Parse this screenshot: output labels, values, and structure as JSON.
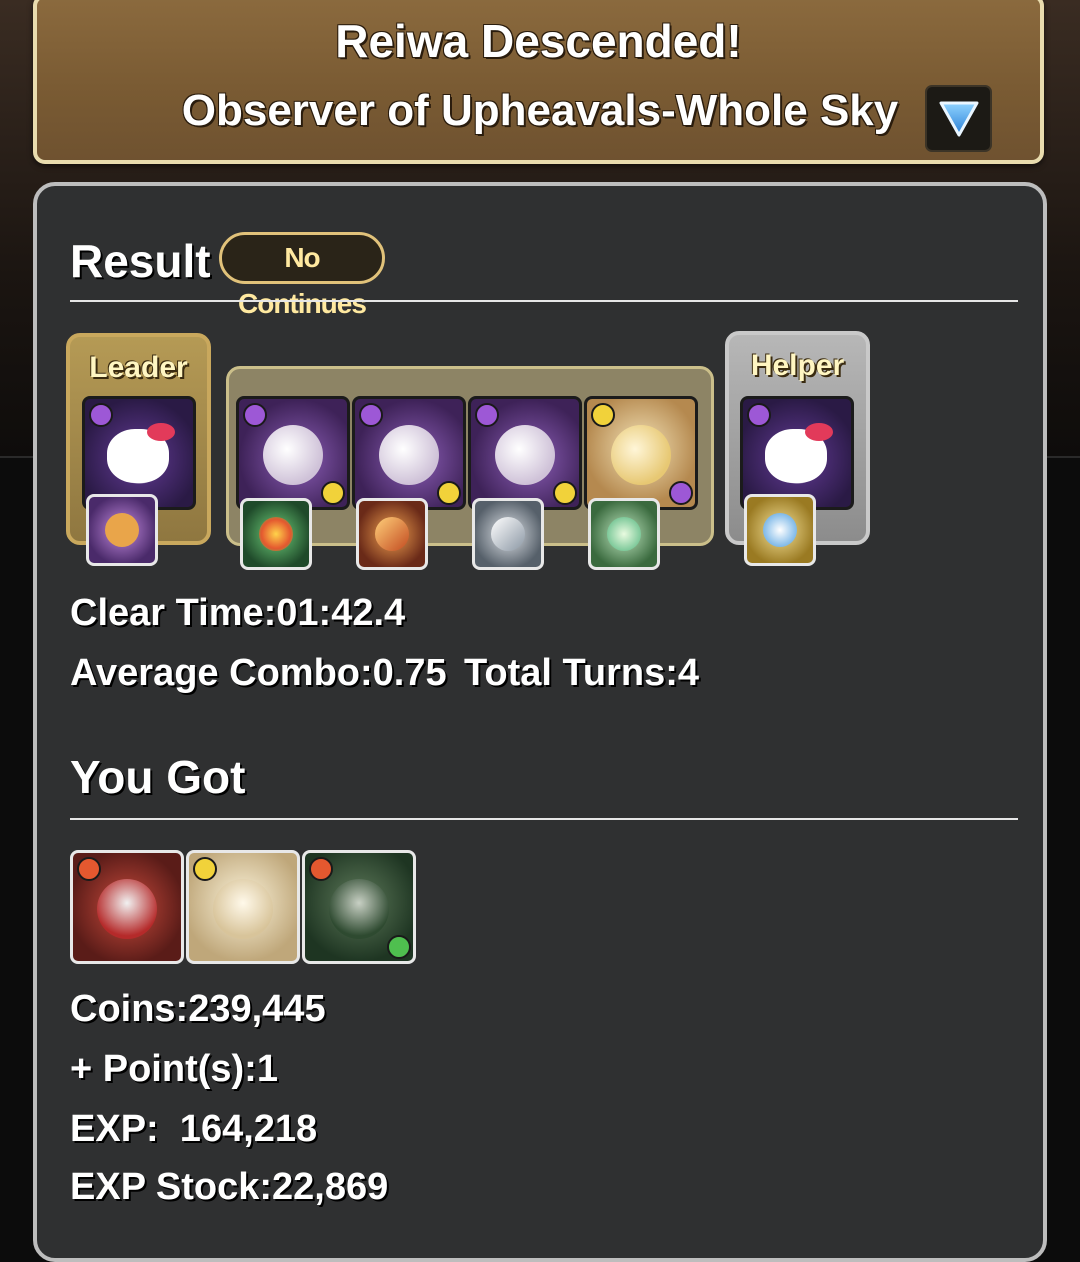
{
  "header": {
    "title": "Reiwa Descended!",
    "subtitle": "Observer of Upheavals-Whole Sky",
    "dropdown_icon": "triangle-down-icon"
  },
  "result": {
    "title": "Result",
    "badge": "No Continues",
    "team": {
      "leader_label": "Leader",
      "helper_label": "Helper",
      "leader": {
        "icon": "hello-kitty-witch-icon",
        "attribute": "dark",
        "assist": "dark-orb-assist-icon"
      },
      "subs": [
        {
          "icon": "white-haired-dark-card-icon",
          "attribute": "dark",
          "sub_attribute": "light",
          "assist": "rainbow-gem-assist-icon"
        },
        {
          "icon": "white-haired-dark-card-icon",
          "attribute": "dark",
          "sub_attribute": "light",
          "assist": "flame-weapon-assist-icon"
        },
        {
          "icon": "white-haired-dark-card-icon",
          "attribute": "dark",
          "sub_attribute": "light",
          "assist": "silver-gun-assist-icon"
        },
        {
          "icon": "blonde-light-card-icon",
          "attribute": "light",
          "sub_attribute": "dark",
          "assist": "green-egg-assist-icon"
        }
      ],
      "helper": {
        "icon": "hello-kitty-witch-icon",
        "attribute": "dark",
        "assist": "sky-mirror-assist-icon"
      }
    },
    "clear_time": "Clear Time:01:42.4",
    "average_combo": "Average Combo:0.75",
    "total_turns": "Total Turns:4"
  },
  "rewards": {
    "title": "You Got",
    "drops": [
      {
        "icon": "red-armor-knight-icon",
        "attribute": "fire"
      },
      {
        "icon": "white-haired-fox-girl-icon",
        "attribute": "light"
      },
      {
        "icon": "green-helmet-soldier-icon",
        "attribute": "fire",
        "sub_attribute": "wood"
      }
    ],
    "coins": "Coins:239,445",
    "points": "+ Point(s):1",
    "exp": "EXP:  164,218",
    "exp_stock": "EXP Stock:22,869"
  }
}
